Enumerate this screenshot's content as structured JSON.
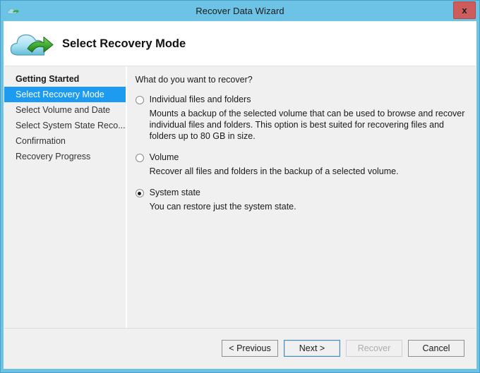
{
  "window": {
    "title": "Recover Data Wizard",
    "title_icon": "cloud-restore-icon",
    "close_label": "x",
    "titlebar_color": "#6cc3e6",
    "close_color": "#cd5c5c"
  },
  "header": {
    "icon": "cloud-restore-icon",
    "title": "Select Recovery Mode"
  },
  "sidebar": {
    "items": [
      {
        "label": "Getting Started",
        "state": "done"
      },
      {
        "label": "Select Recovery Mode",
        "state": "active"
      },
      {
        "label": "Select Volume and Date",
        "state": "pending"
      },
      {
        "label": "Select System State Reco...",
        "state": "pending"
      },
      {
        "label": "Confirmation",
        "state": "pending"
      },
      {
        "label": "Recovery Progress",
        "state": "pending"
      }
    ],
    "active_color": "#1d9bf0"
  },
  "content": {
    "question": "What do you want to recover?",
    "options": [
      {
        "label": "Individual files and folders",
        "description": "Mounts a backup of the selected volume that can be used to browse and recover individual files and folders. This option is best suited for recovering files and folders up to 80 GB in size.",
        "selected": false
      },
      {
        "label": "Volume",
        "description": "Recover all files and folders in the backup of a selected volume.",
        "selected": false
      },
      {
        "label": "System state",
        "description": "You can restore just the system state.",
        "selected": true
      }
    ]
  },
  "footer": {
    "buttons": [
      {
        "label": "< Previous",
        "state": "normal"
      },
      {
        "label": "Next >",
        "state": "focused"
      },
      {
        "label": "Recover",
        "state": "disabled"
      },
      {
        "label": "Cancel",
        "state": "normal"
      }
    ]
  }
}
